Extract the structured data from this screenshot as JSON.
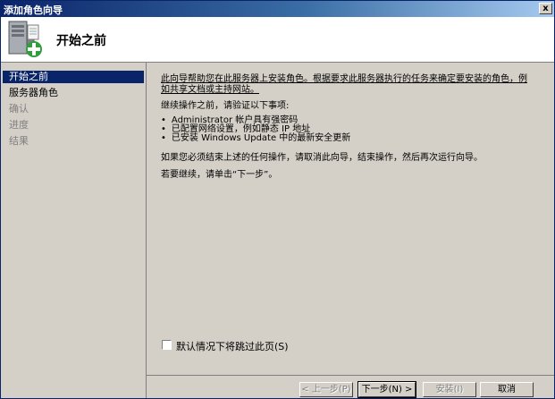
{
  "window": {
    "title": "添加角色向导",
    "close_glyph": "x"
  },
  "header": {
    "title": "开始之前",
    "icon": "server-add-icon"
  },
  "sidebar": {
    "items": [
      {
        "label": "开始之前",
        "state": "active"
      },
      {
        "label": "服务器角色",
        "state": "enabled"
      },
      {
        "label": "确认",
        "state": "disabled"
      },
      {
        "label": "进度",
        "state": "disabled"
      },
      {
        "label": "结果",
        "state": "disabled"
      }
    ]
  },
  "content": {
    "intro": "此向导帮助您在此服务器上安装角色。根据要求此服务器执行的任务来确定要安装的角色，例如共享文档或主持网站。",
    "pre_check": "继续操作之前，请验证以下事项:",
    "bullets": [
      "Administrator 帐户具有强密码",
      "已配置网络设置，例如静态 IP 地址",
      "已安装 Windows Update 中的最新安全更新"
    ],
    "cancel_text": "如果您必须结束上述的任何操作，请取消此向导，结束操作，然后再次运行向导。",
    "next_text": "若要继续，请单击“下一步”。"
  },
  "skip_checkbox": {
    "label": "默认情况下将跳过此页(S)",
    "checked": false
  },
  "buttons": {
    "prev": "< 上一步(P)",
    "next": "下一步(N) >",
    "install": "安装(I)",
    "cancel": "取消"
  },
  "colors": {
    "title_bar": "#0a246a",
    "selected": "#0a246a",
    "disabled_text": "#808080"
  }
}
